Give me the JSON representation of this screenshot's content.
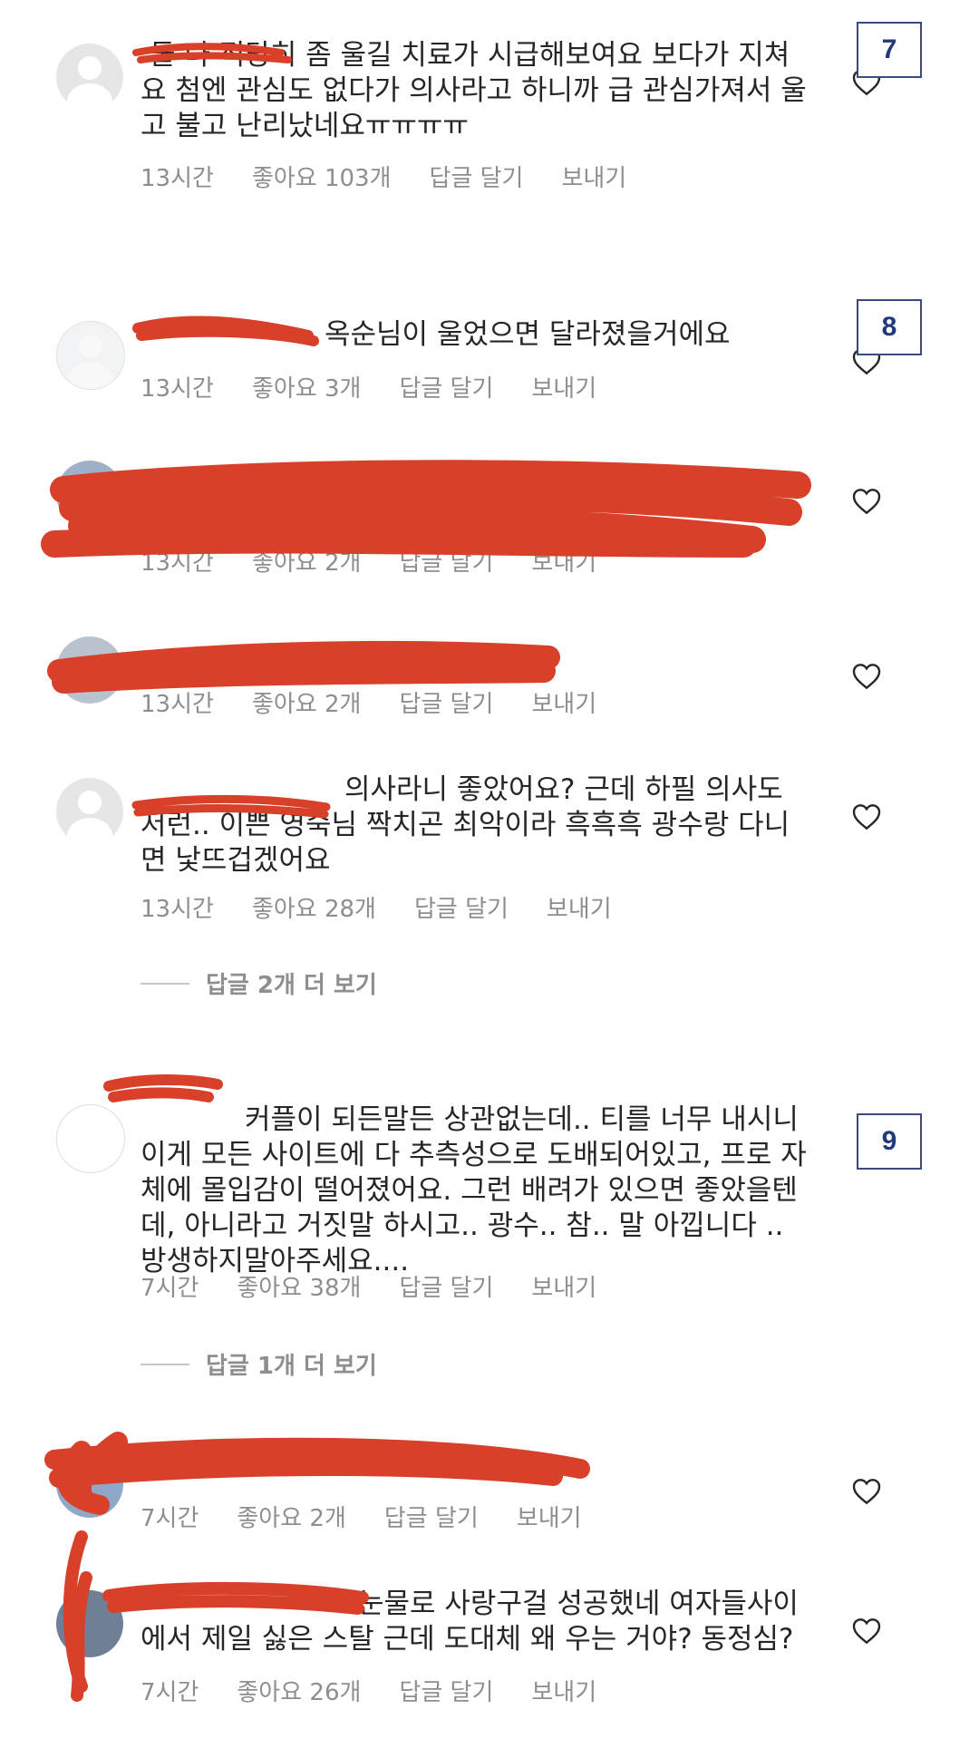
{
  "tags": [
    "7",
    "8",
    "9"
  ],
  "comments": [
    {
      "username": "",
      "text": "둘 다 적당히 좀 울길 치료가 시급해보여요 보다가 지쳐요 첨엔 관심도 없다가 의사라고 하니까 급 관심가져서 울고 불고 난리났네요ㅠㅠㅠㅠ",
      "time": "13시간",
      "likes": "좋아요 103개",
      "reply": "답글 달기",
      "send": "보내기"
    },
    {
      "username": "",
      "text": "옥순님이 울었으면 달라졌을거에요",
      "time": "13시간",
      "likes": "좋아요 3개",
      "reply": "답글 달기",
      "send": "보내기"
    },
    {
      "username": "",
      "text": "",
      "time": "13시간",
      "likes": "좋아요 2개",
      "reply": "답글 달기",
      "send": "보내기"
    },
    {
      "username": "",
      "text": "",
      "time": "13시간",
      "likes": "좋아요 2개",
      "reply": "답글 달기",
      "send": "보내기"
    },
    {
      "username": "",
      "text": "의사라니 좋았어요? 근데 하필 의사도 저런.. 이쁜 영숙님 짝치곤 최악이라 흑흑흑 광수랑 다니면 낯뜨겁겠어요",
      "time": "13시간",
      "likes": "좋아요 28개",
      "reply": "답글 달기",
      "send": "보내기"
    },
    {
      "username": "",
      "text": "커플이 되든말든 상관없는데.. 티를 너무 내시니 이게 모든 사이트에 다 추측성으로 도배되어있고, 프로 자체에 몰입감이 떨어졌어요. 그런 배려가 있으면 좋았을텐데, 아니라고 거짓말 하시고.. 광수.. 참.. 말 아낍니다 .. 방생하지말아주세요....",
      "time": "7시간",
      "likes": "좋아요 38개",
      "reply": "답글 달기",
      "send": "보내기"
    },
    {
      "username": "",
      "text": "",
      "time": "7시간",
      "likes": "좋아요 2개",
      "reply": "답글 달기",
      "send": "보내기"
    },
    {
      "username": "",
      "text": "눈물로 사랑구걸 성공했네 여자들사이에서 제일 싫은 스탈 근데 도대체 왜 우는 거야? 동정심?",
      "time": "7시간",
      "likes": "좋아요 26개",
      "reply": "답글 달기",
      "send": "보내기"
    }
  ],
  "view_more": [
    "답글 2개 더 보기",
    "답글 1개 더 보기"
  ],
  "icons": {
    "heart": "heart-outline-icon",
    "avatar": "default-avatar-icon"
  },
  "colors": {
    "text": "#262626",
    "meta": "#8e8e8e",
    "redaction": "#d8402a",
    "tag_border": "#3a4a80"
  }
}
